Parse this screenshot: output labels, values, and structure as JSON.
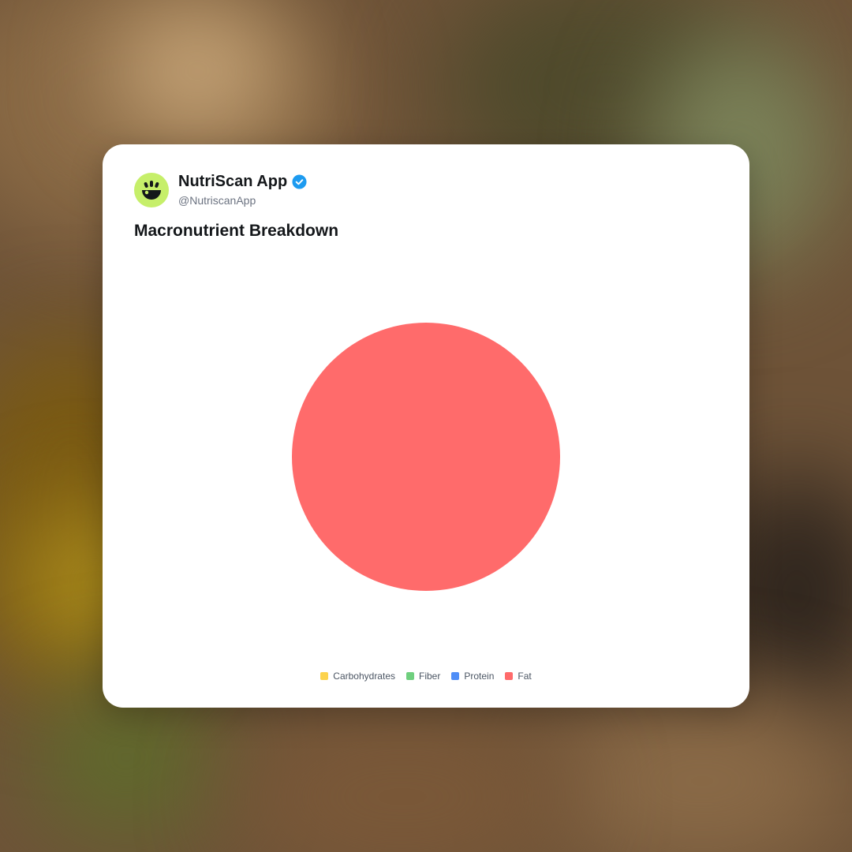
{
  "account": {
    "name": "NutriScan App",
    "handle": "@NutriscanApp",
    "verified": true,
    "avatar_color": "#c6ef6a",
    "verified_color": "#1d9bf0"
  },
  "chart_data": {
    "type": "pie",
    "title": "Macronutrient Breakdown",
    "categories": [
      "Carbohydrates",
      "Fiber",
      "Protein",
      "Fat"
    ],
    "values": [
      0,
      0,
      0,
      100
    ],
    "colors": [
      "#fcd34d",
      "#6fcf7e",
      "#4f8ef7",
      "#ff6b6b"
    ],
    "legend": "bottom"
  }
}
